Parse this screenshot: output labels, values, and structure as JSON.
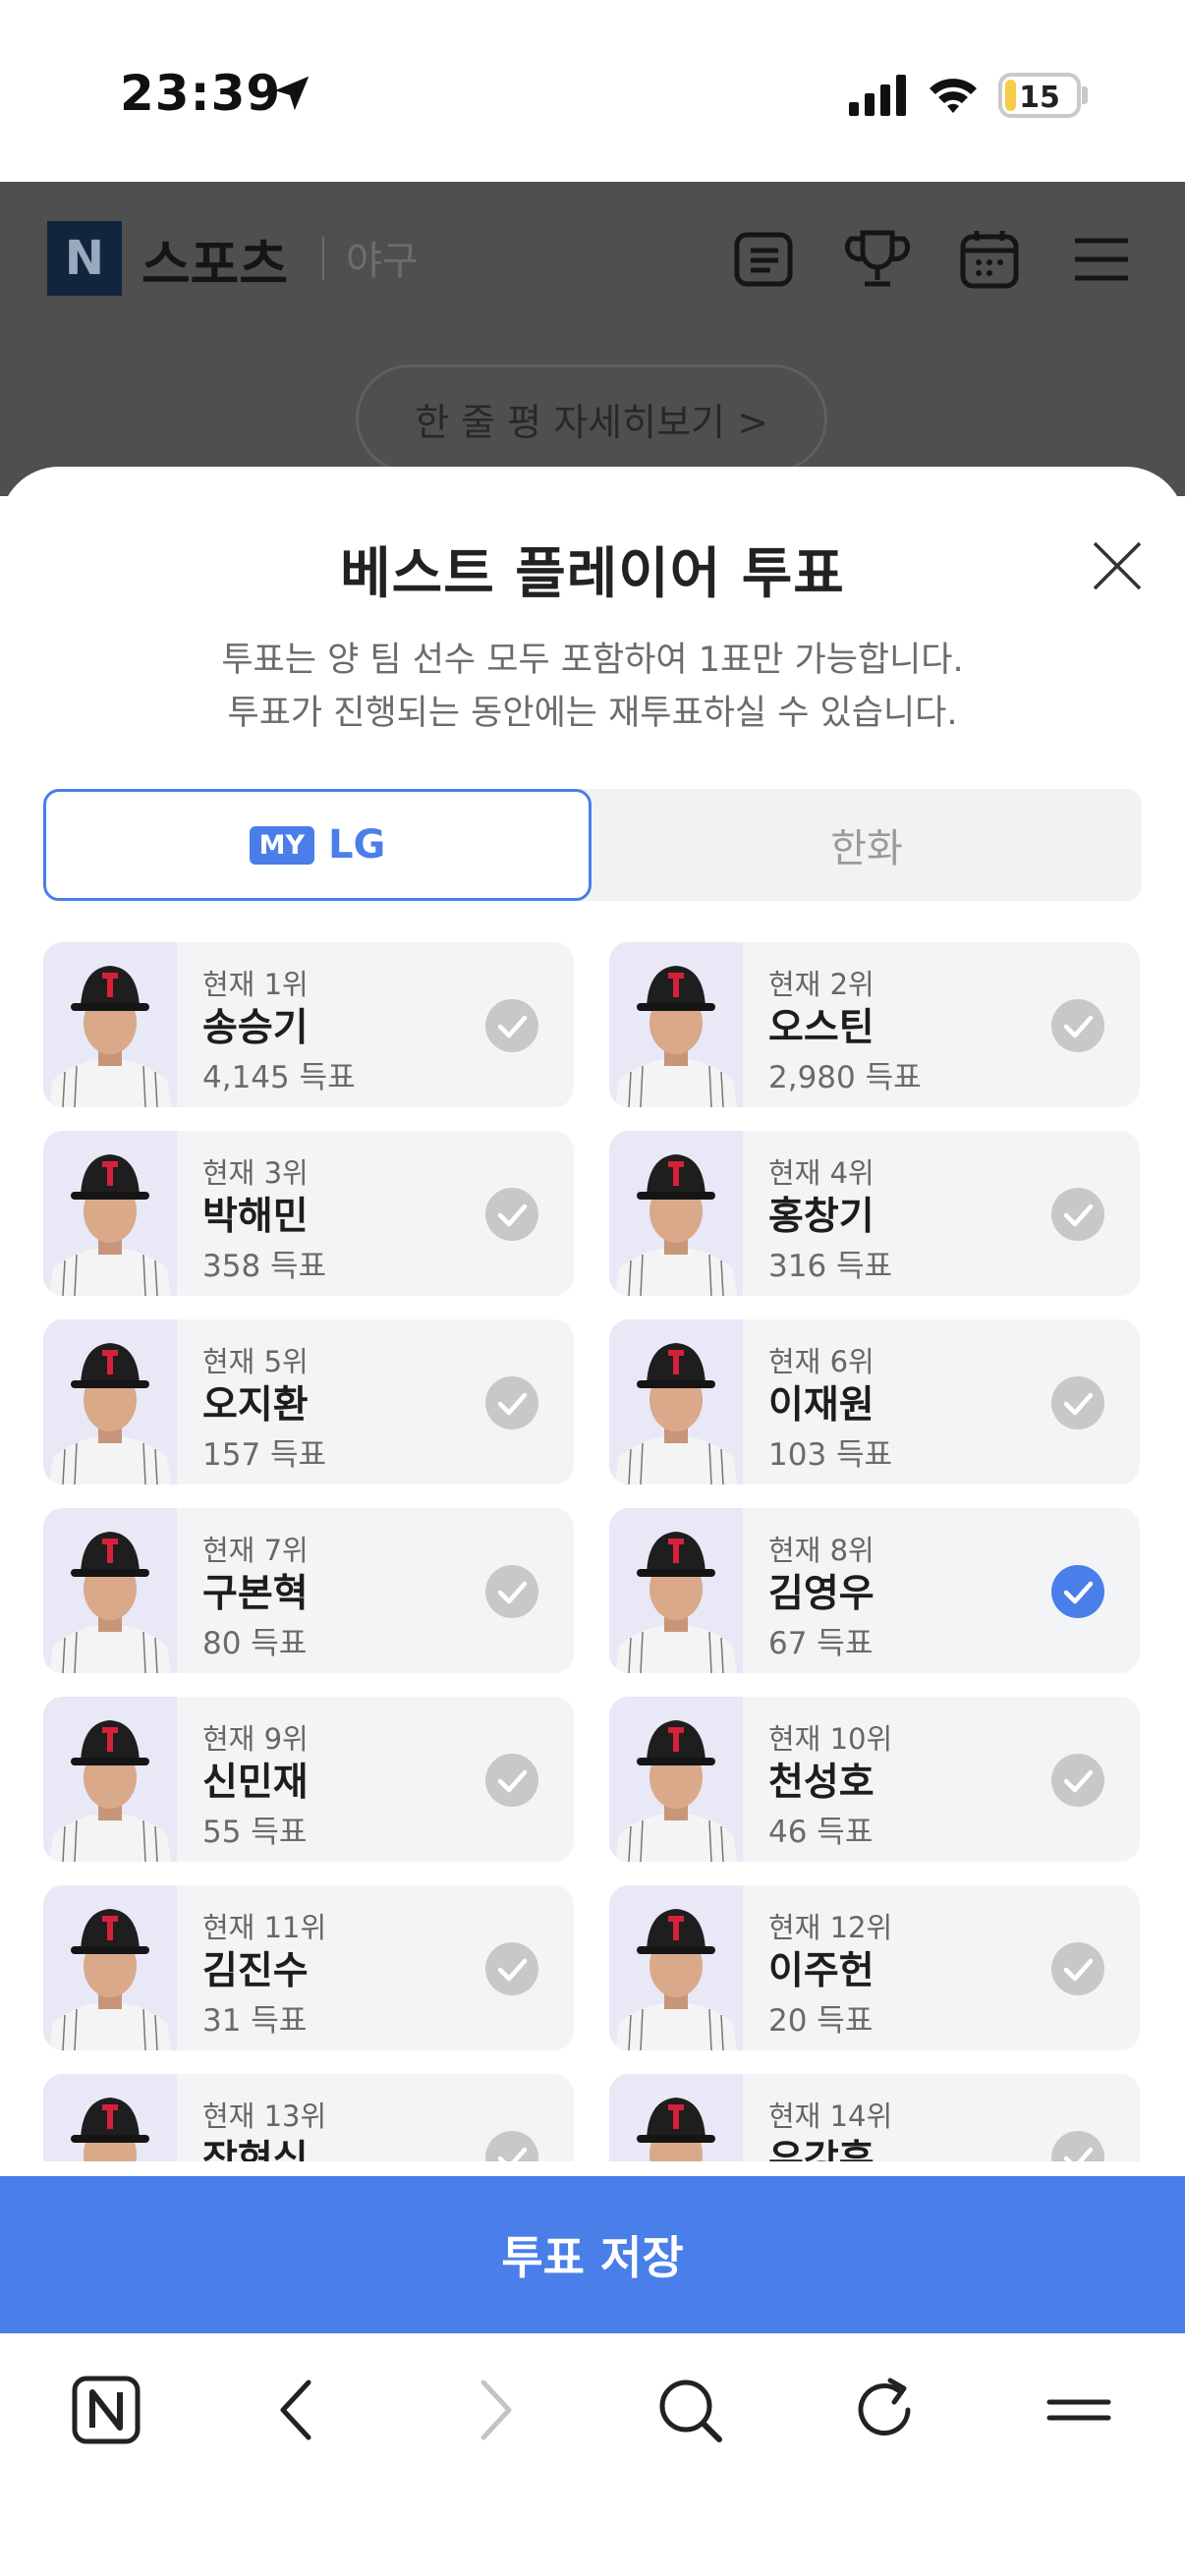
{
  "status": {
    "time": "23:39",
    "battery": "15"
  },
  "background": {
    "logo_letter": "N",
    "brand": "스포츠",
    "section": "야구",
    "review_link": "한 줄 평 자세히보기 >"
  },
  "sheet": {
    "title": "베스트 플레이어 투표",
    "desc_line1": "투표는 양 팀 선수 모두 포함하여 1표만 가능합니다.",
    "desc_line2": "투표가 진행되는 동안에는 재투표하실 수 있습니다.",
    "tabs": {
      "my_badge": "MY",
      "team1": "LG",
      "team2": "한화"
    }
  },
  "players": [
    {
      "rank": "현재 1위",
      "name": "송승기",
      "votes": "4,145 득표",
      "selected": false
    },
    {
      "rank": "현재 2위",
      "name": "오스틴",
      "votes": "2,980 득표",
      "selected": false
    },
    {
      "rank": "현재 3위",
      "name": "박해민",
      "votes": "358 득표",
      "selected": false
    },
    {
      "rank": "현재 4위",
      "name": "홍창기",
      "votes": "316 득표",
      "selected": false
    },
    {
      "rank": "현재 5위",
      "name": "오지환",
      "votes": "157 득표",
      "selected": false
    },
    {
      "rank": "현재 6위",
      "name": "이재원",
      "votes": "103 득표",
      "selected": false
    },
    {
      "rank": "현재 7위",
      "name": "구본혁",
      "votes": "80 득표",
      "selected": false
    },
    {
      "rank": "현재 8위",
      "name": "김영우",
      "votes": "67 득표",
      "selected": true
    },
    {
      "rank": "현재 9위",
      "name": "신민재",
      "votes": "55 득표",
      "selected": false
    },
    {
      "rank": "현재 10위",
      "name": "천성호",
      "votes": "46 득표",
      "selected": false
    },
    {
      "rank": "현재 11위",
      "name": "김진수",
      "votes": "31 득표",
      "selected": false
    },
    {
      "rank": "현재 12위",
      "name": "이주헌",
      "votes": "20 득표",
      "selected": false
    },
    {
      "rank": "현재 13위",
      "name": "장현식",
      "votes": "",
      "selected": false
    },
    {
      "rank": "현재 14위",
      "name": "우강훈",
      "votes": "",
      "selected": false
    }
  ],
  "save_button": "투표 저장",
  "colors": {
    "accent": "#4a7ee8",
    "check_default": "#c8c8c8",
    "card_bg": "#f3f4f6"
  },
  "browser_nav": [
    "naver-home-icon",
    "back-icon",
    "forward-icon",
    "search-icon",
    "reload-icon",
    "menu-icon"
  ]
}
